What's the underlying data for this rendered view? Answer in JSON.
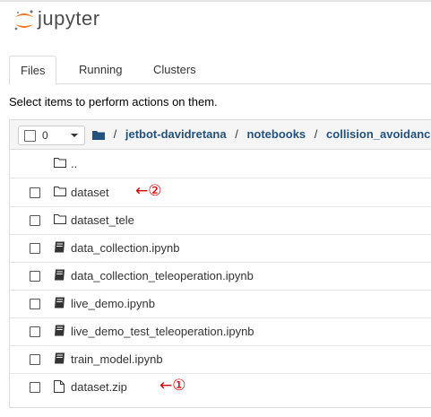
{
  "app": {
    "logo_text": "jupyter"
  },
  "tabs": [
    {
      "label": "Files",
      "active": true
    },
    {
      "label": "Running",
      "active": false
    },
    {
      "label": "Clusters",
      "active": false
    }
  ],
  "hint": "Select items to perform actions on them.",
  "toolbar": {
    "selected_count": "0"
  },
  "breadcrumb": {
    "separator": "/",
    "parts": [
      "jetbot-davidretana",
      "notebooks",
      "collision_avoidance"
    ]
  },
  "rows": {
    "parent": {
      "name": "..",
      "icon": "folder-icon"
    },
    "items": [
      {
        "name": "dataset",
        "icon": "folder-icon",
        "annotation": "←②"
      },
      {
        "name": "dataset_tele",
        "icon": "folder-icon"
      },
      {
        "name": "data_collection.ipynb",
        "icon": "notebook-icon"
      },
      {
        "name": "data_collection_teleoperation.ipynb",
        "icon": "notebook-icon"
      },
      {
        "name": "live_demo.ipynb",
        "icon": "notebook-icon"
      },
      {
        "name": "live_demo_test_teleoperation.ipynb",
        "icon": "notebook-icon"
      },
      {
        "name": "train_model.ipynb",
        "icon": "notebook-icon"
      },
      {
        "name": "dataset.zip",
        "icon": "file-icon",
        "annotation": "←①"
      }
    ]
  },
  "colors": {
    "link": "#23527c",
    "annotation": "#cc0000",
    "logo_orange": "#f37726"
  }
}
